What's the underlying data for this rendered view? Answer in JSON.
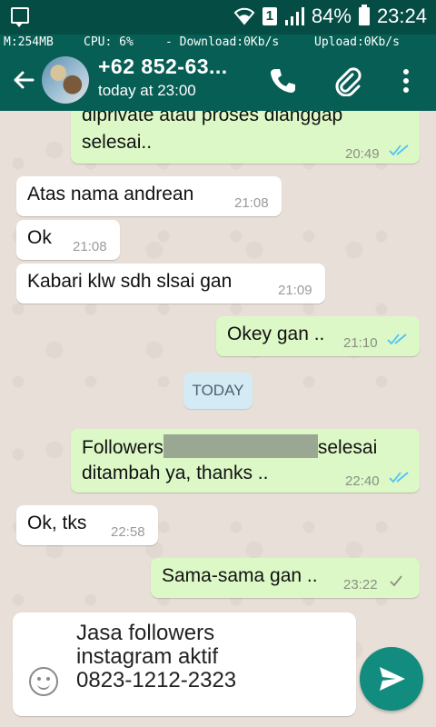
{
  "status_bar": {
    "battery": "84%",
    "time": "23:24",
    "sim_slot": "1"
  },
  "monitor": {
    "memory": "M:254MB",
    "cpu": "CPU: 6%",
    "download": "- Download:0Kb/s",
    "upload": "Upload:0Kb/s"
  },
  "header": {
    "contact_name": "+62 852-63...",
    "last_seen": "today at 23:00"
  },
  "messages": [
    {
      "dir": "out",
      "lines": [
        "diprivate atau proses dianggap",
        "selesai.."
      ],
      "time": "20:49",
      "ticks": "double-blue"
    },
    {
      "dir": "in",
      "text": "Atas nama andrean",
      "time": "21:08"
    },
    {
      "dir": "in",
      "text": "Ok",
      "time": "21:08"
    },
    {
      "dir": "in",
      "text": "Kabari klw sdh slsai gan",
      "time": "21:09"
    },
    {
      "dir": "out",
      "text": "Okey gan ..",
      "time": "21:10",
      "ticks": "double-blue"
    },
    {
      "dir": "out",
      "line1_before": "Followers",
      "line1_after": "selesai",
      "line2": "ditambah ya, thanks ..",
      "time": "22:40",
      "ticks": "double-blue"
    },
    {
      "dir": "in",
      "text": "Ok, tks",
      "time": "22:58"
    },
    {
      "dir": "out",
      "text": "Sama-sama gan ..",
      "time": "23:22",
      "ticks": "single-gray"
    }
  ],
  "day_separator": "TODAY",
  "composer": {
    "text": "Jasa followers\ninstagram aktif\n0823-1212-2323"
  },
  "colors": {
    "header": "#075e54",
    "statusbar": "#054d44",
    "outgoing_bubble": "#dcf8c6",
    "incoming_bubble": "#ffffff",
    "send_button": "#128c7e",
    "read_tick": "#4fc3f7"
  },
  "icons": [
    "notification-icon",
    "wifi-icon",
    "sim-icon",
    "signal-icon",
    "battery-icon",
    "back-arrow-icon",
    "phone-icon",
    "attachment-icon",
    "more-vert-icon",
    "emoji-icon",
    "send-icon"
  ]
}
